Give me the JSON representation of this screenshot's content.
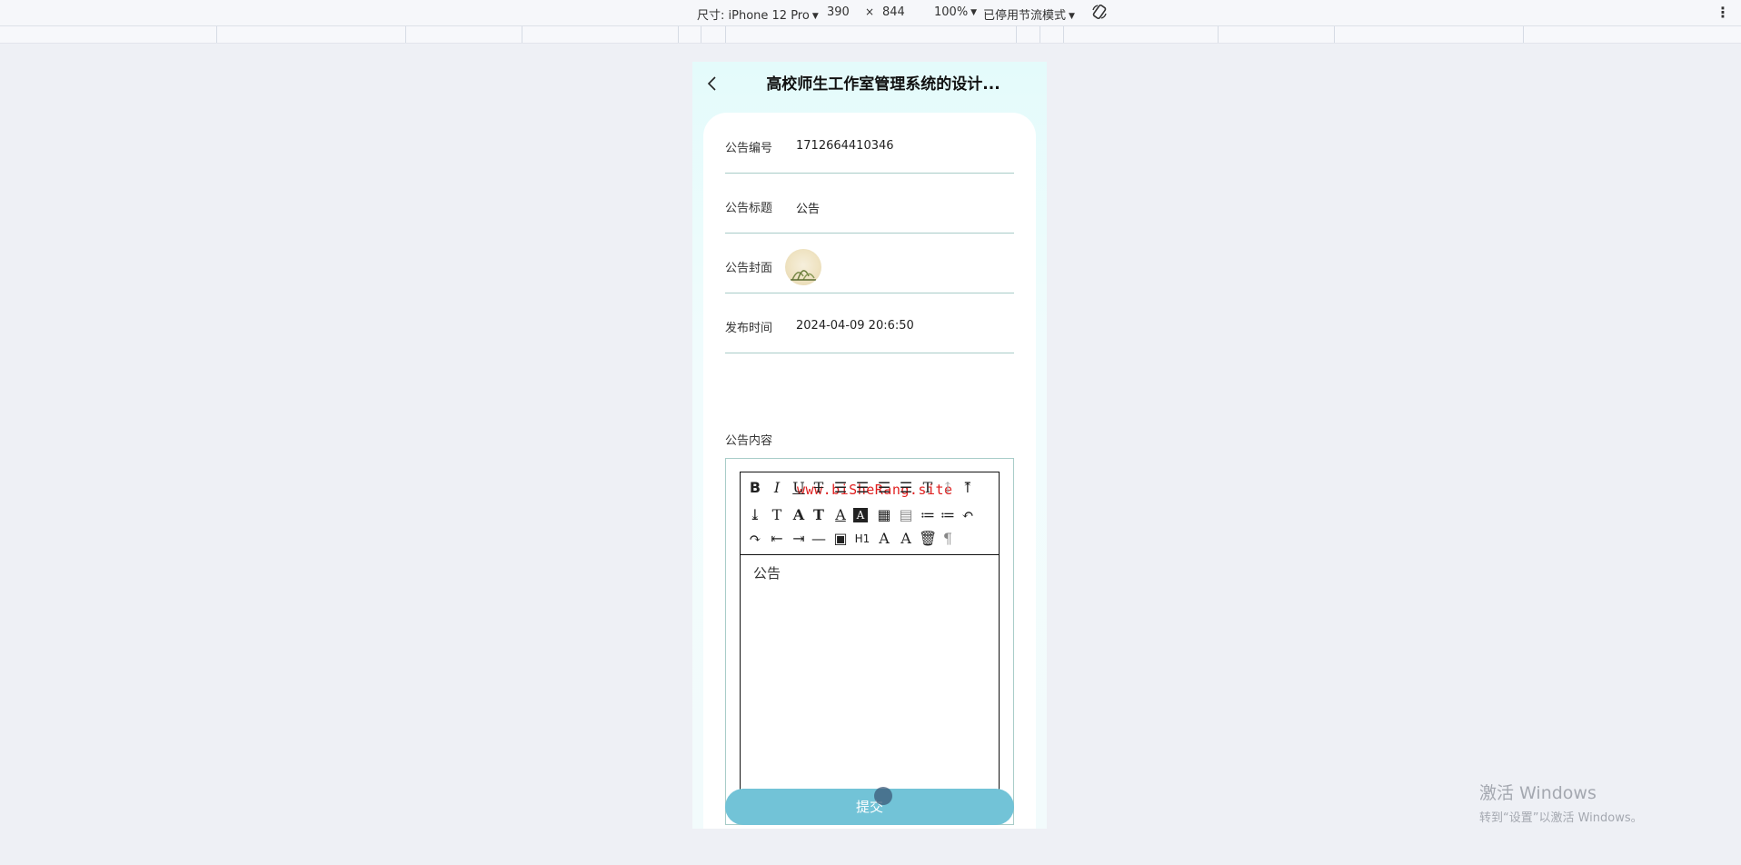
{
  "devtools": {
    "size_label": "尺寸: iPhone 12 Pro",
    "width": "390",
    "times": "×",
    "height": "844",
    "zoom": "100%",
    "throttle": "已停用节流模式",
    "rotate_icon": "rotate-icon",
    "menu_icon": "kebab-icon"
  },
  "page": {
    "title": "高校师生工作室管理系统的设计..."
  },
  "form": {
    "fields": [
      {
        "label": "公告编号",
        "value": "1712664410346"
      },
      {
        "label": "公告标题",
        "value": "公告"
      },
      {
        "label": "公告封面",
        "value": ""
      },
      {
        "label": "发布时间",
        "value": "2024-04-09 20:6:50"
      }
    ],
    "content_label": "公告内容",
    "editor_watermark": "www.biSheRang.site",
    "editor_text": "公告",
    "submit_label": "提交"
  },
  "os": {
    "activate_title": "激活 Windows",
    "activate_sub": "转到“设置”以激活 Windows。"
  },
  "colors": {
    "accent": "#72c3d7",
    "divider": "#a8ccc8",
    "page_bg": "#eef0f5"
  }
}
